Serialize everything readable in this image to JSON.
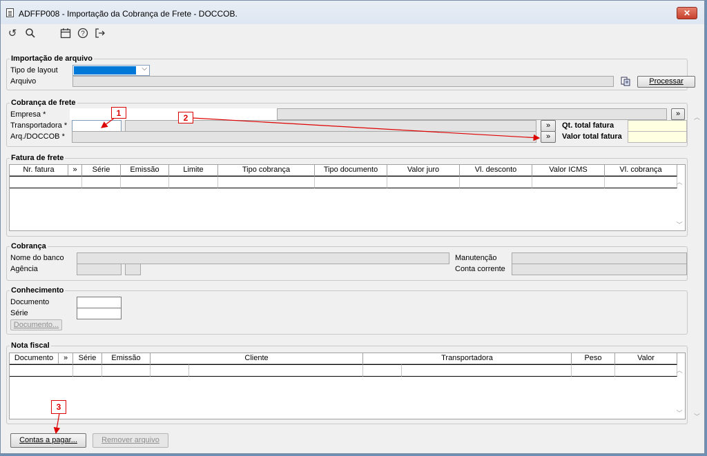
{
  "window": {
    "title": "ADFFP008 - Importação da Cobrança de Frete - DOCCOB.",
    "close_label": "✕"
  },
  "toolbar": {
    "icons": [
      "undo-icon",
      "search-icon",
      "calendar-icon",
      "help-icon",
      "exit-icon"
    ]
  },
  "importacao": {
    "legend": "Importação de arquivo",
    "tipo_layout_label": "Tipo de layout",
    "arquivo_label": "Arquivo",
    "processar_label": "Processar"
  },
  "cobranca_frete": {
    "legend": "Cobrança de frete",
    "empresa_label": "Empresa *",
    "transportadora_label": "Transportadora *",
    "arq_label": "Arq./DOCCOB *",
    "more_label": "»",
    "qt_total_label": "Qt. total fatura",
    "valor_total_label": "Valor total fatura"
  },
  "fatura_frete": {
    "legend": "Fatura de frete",
    "columns": [
      "Nr. fatura",
      "»",
      "Série",
      "Emissão",
      "Limite",
      "Tipo cobrança",
      "Tipo documento",
      "Valor juro",
      "Vl. desconto",
      "Valor ICMS",
      "Vl. cobrança"
    ]
  },
  "cobranca": {
    "legend": "Cobrança",
    "nome_banco_label": "Nome do banco",
    "agencia_label": "Agência",
    "manutencao_label": "Manutenção",
    "conta_corrente_label": "Conta corrente"
  },
  "conhecimento": {
    "legend": "Conhecimento",
    "documento_label": "Documento",
    "serie_label": "Série",
    "documento_button": "Documento..."
  },
  "nota_fiscal": {
    "legend": "Nota fiscal",
    "columns": [
      "Documento",
      "»",
      "Série",
      "Emissão",
      "Cliente",
      "Transportadora",
      "Peso",
      "Valor"
    ]
  },
  "footer": {
    "contas_pagar_label": "Contas a pagar...",
    "remover_arquivo_label": "Remover arquivo"
  },
  "callouts": [
    "1",
    "2",
    "3"
  ],
  "colors": {
    "selection": "#0078d7",
    "callout": "#dd0000",
    "highlight": "#ffffe1"
  }
}
